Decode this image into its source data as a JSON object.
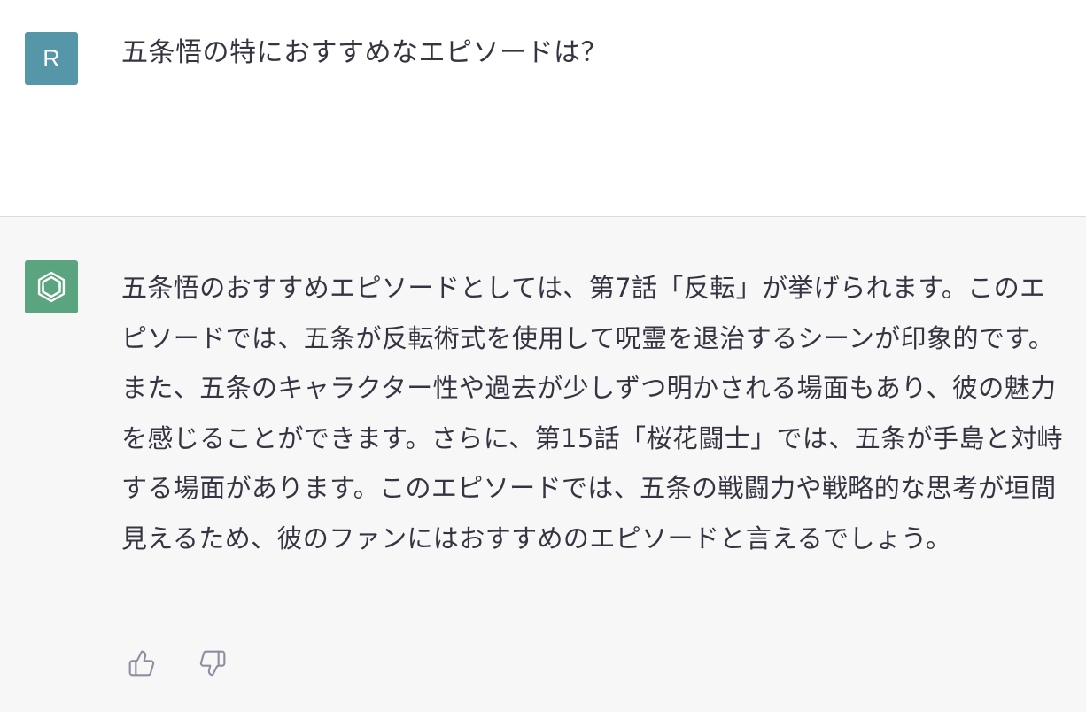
{
  "user": {
    "avatar_letter": "R",
    "message": "五条悟の特におすすめなエピソードは？"
  },
  "assistant": {
    "avatar_icon": "openai-logo-icon",
    "message": "五条悟のおすすめエピソードとしては、第7話「反転」が挙げられます。このエピソードでは、五条が反転術式を使用して呪霊を退治するシーンが印象的です。また、五条のキャラクター性や過去が少しずつ明かされる場面もあり、彼の魅力を感じることができます。さらに、第15話「桜花闘士」では、五条が手島と対峙する場面があります。このエピソードでは、五条の戦闘力や戦略的な思考が垣間見えるため、彼のファンにはおすすめのエピソードと言えるでしょう。"
  },
  "feedback": {
    "thumbs_up_icon": "thumbs-up-icon",
    "thumbs_down_icon": "thumbs-down-icon"
  },
  "colors": {
    "user_avatar_bg": "#5596a8",
    "assistant_avatar_bg": "#5aa57f",
    "assistant_bg": "#f7f7f8",
    "text": "#343541",
    "icon": "#8e8ea0"
  }
}
